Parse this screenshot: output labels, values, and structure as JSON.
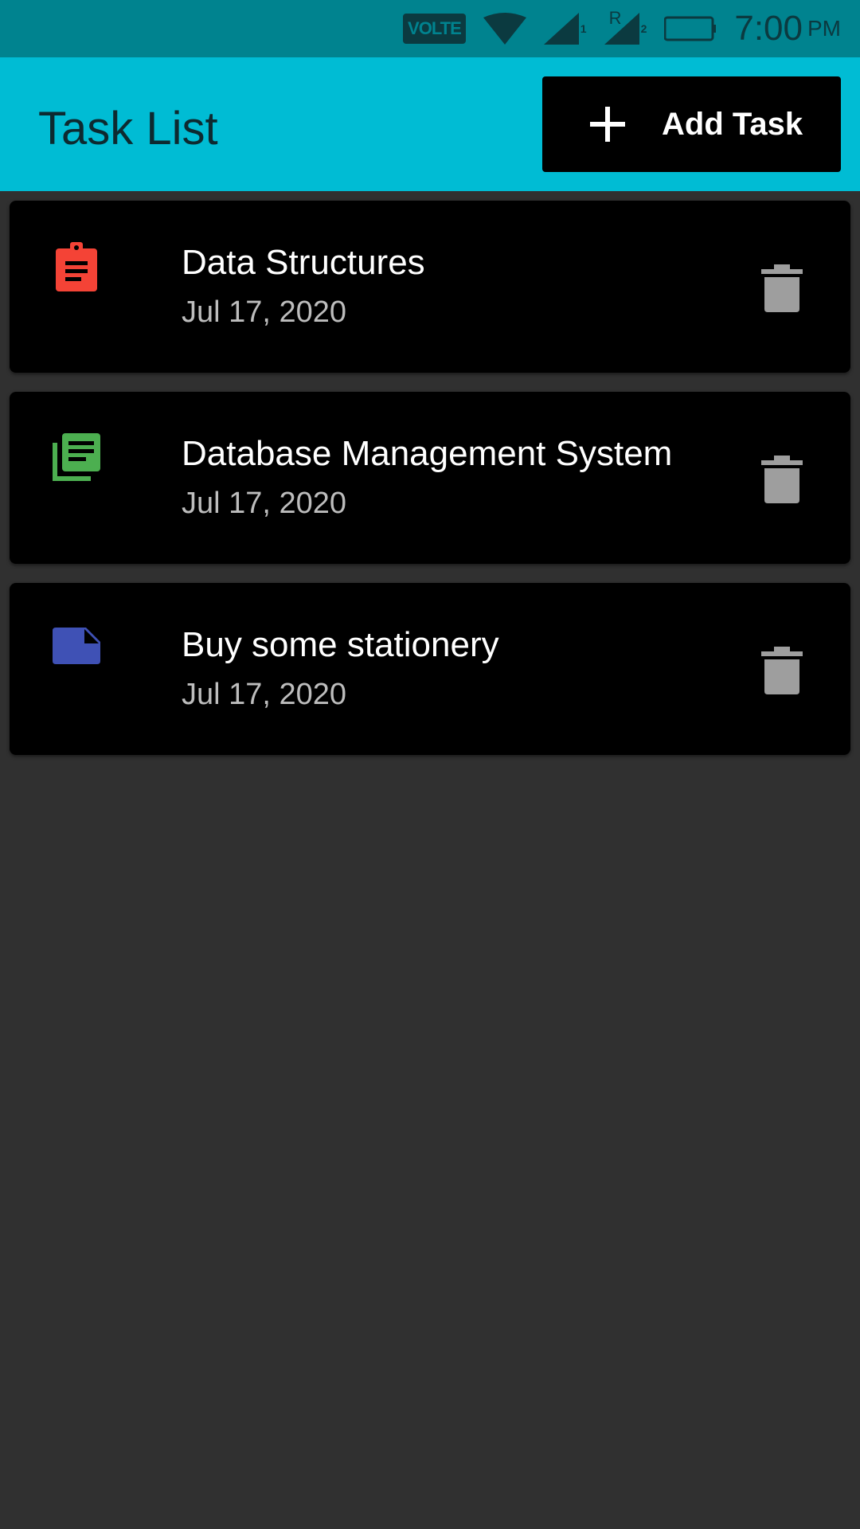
{
  "status_bar": {
    "volte_label": "VOLTE",
    "sim1_label": "1",
    "sim2_label": "2",
    "roaming_label": "R",
    "time": "7:00",
    "ampm": "PM"
  },
  "app_bar": {
    "title": "Task List",
    "add_button_label": "Add Task",
    "background_color": "#00bcd4"
  },
  "tasks": [
    {
      "title": "Data Structures",
      "date": "Jul 17, 2020",
      "icon": "assignment-icon",
      "icon_color": "#f44336"
    },
    {
      "title": "Database Management System",
      "date": "Jul 17, 2020",
      "icon": "library-books-icon",
      "icon_color": "#4caf50"
    },
    {
      "title": "Buy some stationery",
      "date": "Jul 17, 2020",
      "icon": "note-icon",
      "icon_color": "#3f51b5"
    }
  ]
}
